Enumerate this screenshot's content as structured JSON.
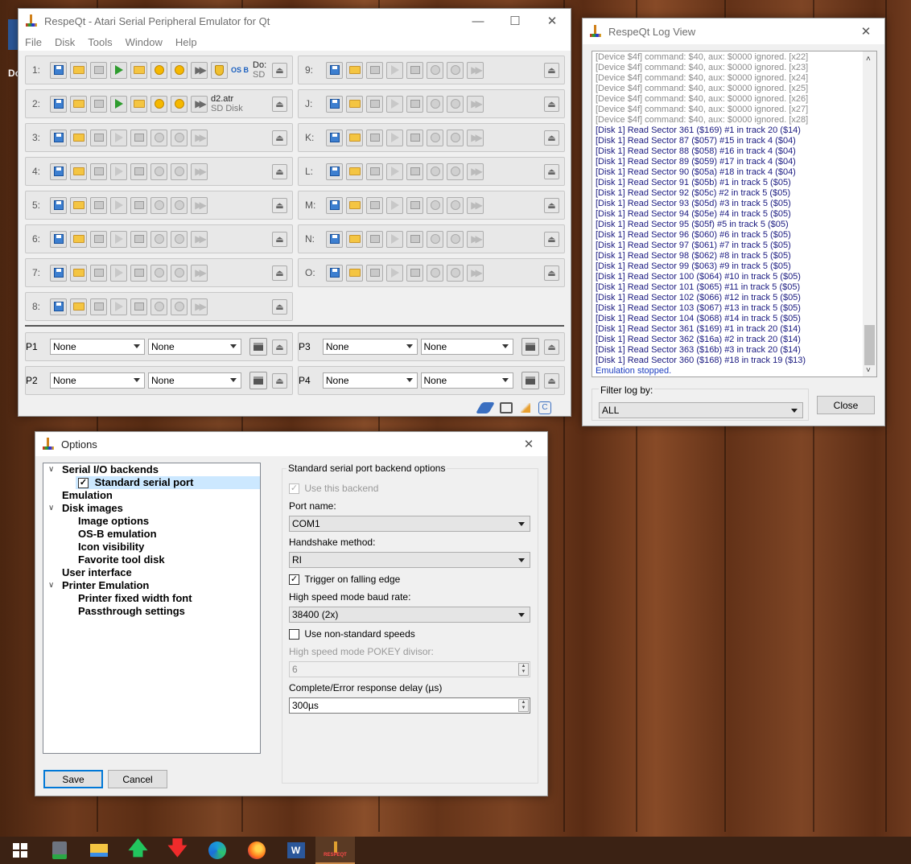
{
  "desktop": {
    "partial_label": "Do"
  },
  "main_window": {
    "title": "RespeQt - Atari Serial Peripheral Emulator for Qt",
    "menu": [
      "File",
      "Disk",
      "Tools",
      "Window",
      "Help"
    ],
    "left_slots": [
      {
        "label": "1:",
        "active": true,
        "image_name": "Do:",
        "image_sub": "SD"
      },
      {
        "label": "2:",
        "active": true,
        "image_name": "d2.atr",
        "image_sub": "SD Disk"
      },
      {
        "label": "3:",
        "active": false
      },
      {
        "label": "4:",
        "active": false
      },
      {
        "label": "5:",
        "active": false
      },
      {
        "label": "6:",
        "active": false
      },
      {
        "label": "7:",
        "active": false
      },
      {
        "label": "8:",
        "active": false
      }
    ],
    "right_slots": [
      {
        "label": "9:"
      },
      {
        "label": "J:"
      },
      {
        "label": "K:"
      },
      {
        "label": "L:"
      },
      {
        "label": "M:"
      },
      {
        "label": "N:"
      },
      {
        "label": "O:"
      }
    ],
    "printers": [
      {
        "label": "P1",
        "type": "None",
        "device": "None"
      },
      {
        "label": "P2",
        "type": "None",
        "device": "None"
      },
      {
        "label": "P3",
        "type": "None",
        "device": "None"
      },
      {
        "label": "P4",
        "type": "None",
        "device": "None"
      }
    ],
    "os_badge": "OS B"
  },
  "log_window": {
    "title": "RespeQt Log View",
    "lines": [
      "[Device $4f] command: $40, aux: $0000 ignored. [x22]",
      "[Device $4f] command: $40, aux: $0000 ignored. [x23]",
      "[Device $4f] command: $40, aux: $0000 ignored. [x24]",
      "[Device $4f] command: $40, aux: $0000 ignored. [x25]",
      "[Device $4f] command: $40, aux: $0000 ignored. [x26]",
      "[Device $4f] command: $40, aux: $0000 ignored. [x27]",
      "[Device $4f] command: $40, aux: $0000 ignored. [x28]",
      "[Disk 1] Read Sector 361 ($169) #1 in track 20 ($14)",
      "[Disk 1] Read Sector 87 ($057) #15 in track 4 ($04)",
      "[Disk 1] Read Sector 88 ($058) #16 in track 4 ($04)",
      "[Disk 1] Read Sector 89 ($059) #17 in track 4 ($04)",
      "[Disk 1] Read Sector 90 ($05a) #18 in track 4 ($04)",
      "[Disk 1] Read Sector 91 ($05b) #1 in track 5 ($05)",
      "[Disk 1] Read Sector 92 ($05c) #2 in track 5 ($05)",
      "[Disk 1] Read Sector 93 ($05d) #3 in track 5 ($05)",
      "[Disk 1] Read Sector 94 ($05e) #4 in track 5 ($05)",
      "[Disk 1] Read Sector 95 ($05f) #5 in track 5 ($05)",
      "[Disk 1] Read Sector 96 ($060) #6 in track 5 ($05)",
      "[Disk 1] Read Sector 97 ($061) #7 in track 5 ($05)",
      "[Disk 1] Read Sector 98 ($062) #8 in track 5 ($05)",
      "[Disk 1] Read Sector 99 ($063) #9 in track 5 ($05)",
      "[Disk 1] Read Sector 100 ($064) #10 in track 5 ($05)",
      "[Disk 1] Read Sector 101 ($065) #11 in track 5 ($05)",
      "[Disk 1] Read Sector 102 ($066) #12 in track 5 ($05)",
      "[Disk 1] Read Sector 103 ($067) #13 in track 5 ($05)",
      "[Disk 1] Read Sector 104 ($068) #14 in track 5 ($05)",
      "[Disk 1] Read Sector 361 ($169) #1 in track 20 ($14)",
      "[Disk 1] Read Sector 362 ($16a) #2 in track 20 ($14)",
      "[Disk 1] Read Sector 363 ($16b) #3 in track 20 ($14)",
      "[Disk 1] Read Sector 360 ($168) #18 in track 19 ($13)",
      "Emulation stopped."
    ],
    "filter_label": "Filter log by:",
    "filter_value": "ALL",
    "close_label": "Close",
    "colors": {
      "device": "#8a8a8a",
      "disk": "#1a1a80",
      "status": "#1a3cc0"
    }
  },
  "options": {
    "title": "Options",
    "tree": [
      {
        "label": "Serial I/O backends",
        "expanded": true
      },
      {
        "label": "Standard serial port",
        "selected": true,
        "checked": true
      },
      {
        "label": "Emulation"
      },
      {
        "label": "Disk images",
        "expanded": true
      },
      {
        "label": "Image options"
      },
      {
        "label": "OS-B emulation"
      },
      {
        "label": "Icon visibility"
      },
      {
        "label": "Favorite tool disk"
      },
      {
        "label": "User interface"
      },
      {
        "label": "Printer Emulation",
        "expanded": true
      },
      {
        "label": "Printer fixed width font"
      },
      {
        "label": "Passthrough settings"
      }
    ],
    "group_title": "Standard serial port backend options",
    "use_backend": {
      "label": "Use this backend",
      "checked": true,
      "enabled": false
    },
    "port_name": {
      "label": "Port name:",
      "value": "COM1"
    },
    "handshake": {
      "label": "Handshake method:",
      "value": "RI"
    },
    "falling_edge": {
      "label": "Trigger on falling edge",
      "checked": true
    },
    "baud": {
      "label": "High speed mode baud rate:",
      "value": "38400 (2x)"
    },
    "nonstandard": {
      "label": "Use non-standard speeds",
      "checked": false
    },
    "pokey": {
      "label": "High speed mode POKEY divisor:",
      "value": "6"
    },
    "delay": {
      "label": "Complete/Error response delay (µs)",
      "value": "300µs"
    },
    "save_label": "Save",
    "cancel_label": "Cancel"
  },
  "taskbar": {
    "items": [
      "windows-start-icon",
      "calculator-icon",
      "file-explorer-icon",
      "upload-arrow-icon",
      "download-arrow-icon",
      "edge-icon",
      "firefox-icon",
      "word-icon",
      "respeqt-icon"
    ],
    "respeqt_caption": "RESPEQT"
  }
}
